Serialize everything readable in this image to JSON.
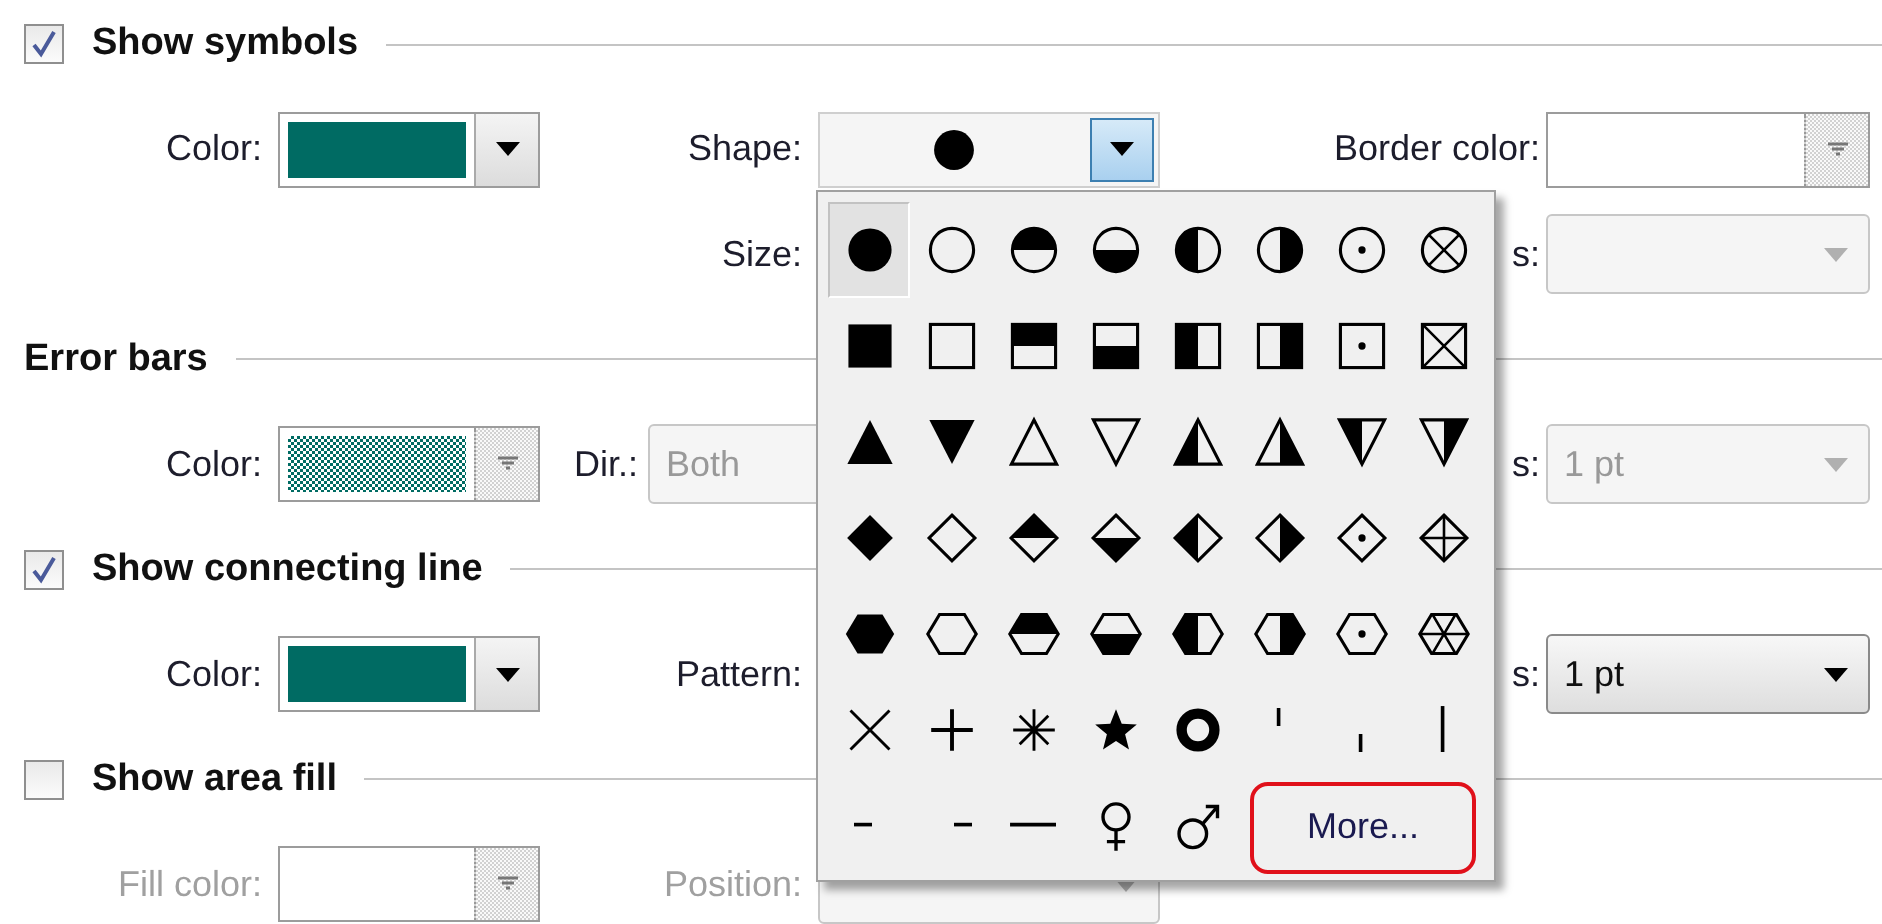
{
  "sections": [
    {
      "kind": "checkbox",
      "title": "Show symbols",
      "checked": true,
      "rows": [
        {
          "left": {
            "label": "Color:",
            "kind": "color",
            "color": "#006b63",
            "disabled": false
          },
          "middle": {
            "label": "Shape:",
            "kind": "shape",
            "expanded": true,
            "menu": {
              "symbols": [
                {
                  "kind": "circle-full",
                  "selected": true
                },
                {
                  "kind": "circle-none",
                  "selected": false
                },
                {
                  "kind": "circle-top",
                  "selected": false
                },
                {
                  "kind": "circle-bottom",
                  "selected": false
                },
                {
                  "kind": "circle-left",
                  "selected": false
                },
                {
                  "kind": "circle-right",
                  "selected": false
                },
                {
                  "kind": "circle-dot",
                  "selected": false
                },
                {
                  "kind": "circle-x",
                  "selected": false
                },
                {
                  "kind": "square-full",
                  "selected": false
                },
                {
                  "kind": "square-none",
                  "selected": false
                },
                {
                  "kind": "square-top",
                  "selected": false
                },
                {
                  "kind": "square-bottom",
                  "selected": false
                },
                {
                  "kind": "square-left",
                  "selected": false
                },
                {
                  "kind": "square-right",
                  "selected": false
                },
                {
                  "kind": "square-dot",
                  "selected": false
                },
                {
                  "kind": "square-x",
                  "selected": false
                },
                {
                  "kind": "triangle-up-full",
                  "selected": false
                },
                {
                  "kind": "triangle-down-full",
                  "selected": false
                },
                {
                  "kind": "triangle-up-none",
                  "selected": false
                },
                {
                  "kind": "triangle-down-none",
                  "selected": false
                },
                {
                  "kind": "triangle-up-left",
                  "selected": false
                },
                {
                  "kind": "triangle-up-right",
                  "selected": false
                },
                {
                  "kind": "triangle-down-left",
                  "selected": false
                },
                {
                  "kind": "triangle-down-right",
                  "selected": false
                },
                {
                  "kind": "diamond-full",
                  "selected": false
                },
                {
                  "kind": "diamond-none",
                  "selected": false
                },
                {
                  "kind": "diamond-top",
                  "selected": false
                },
                {
                  "kind": "diamond-bottom",
                  "selected": false
                },
                {
                  "kind": "diamond-left",
                  "selected": false
                },
                {
                  "kind": "diamond-right",
                  "selected": false
                },
                {
                  "kind": "diamond-dot",
                  "selected": false
                },
                {
                  "kind": "diamond-plus",
                  "selected": false
                },
                {
                  "kind": "hexagon-full",
                  "selected": false
                },
                {
                  "kind": "hexagon-none",
                  "selected": false
                },
                {
                  "kind": "hexagon-top",
                  "selected": false
                },
                {
                  "kind": "hexagon-bottom",
                  "selected": false
                },
                {
                  "kind": "hexagon-left",
                  "selected": false
                },
                {
                  "kind": "hexagon-right",
                  "selected": false
                },
                {
                  "kind": "hexagon-dot",
                  "selected": false
                },
                {
                  "kind": "hexagon-star",
                  "selected": false
                },
                {
                  "kind": "cross",
                  "selected": false
                },
                {
                  "kind": "plus",
                  "selected": false
                },
                {
                  "kind": "asterisk",
                  "selected": false
                },
                {
                  "kind": "star",
                  "selected": false
                },
                {
                  "kind": "ring",
                  "selected": false
                },
                {
                  "kind": "tick-high",
                  "selected": false
                },
                {
                  "kind": "tick-low",
                  "selected": false
                },
                {
                  "kind": "tick-tall",
                  "selected": false
                },
                {
                  "kind": "dash",
                  "selected": false
                },
                {
                  "kind": "dash-right",
                  "selected": false
                },
                {
                  "kind": "dash-long",
                  "selected": false
                },
                {
                  "kind": "female",
                  "selected": false
                },
                {
                  "kind": "male",
                  "selected": false
                }
              ],
              "more_button": "More..."
            }
          },
          "right": {
            "label": "Border color:",
            "kind": "color"
          }
        },
        {
          "middle": {
            "label": "Size:",
            "kind": "label"
          },
          "right": {
            "label": "s:",
            "kind": "select",
            "disabled": true
          }
        }
      ]
    },
    {
      "kind": "heading",
      "title": "Error bars",
      "rows": [
        {
          "left": {
            "label": "Color:",
            "kind": "color",
            "color": "#006b63",
            "disabled": true
          },
          "middle": {
            "label": "Dir.:",
            "kind": "inline-select",
            "value": "Both",
            "disabled": true
          },
          "right": {
            "label": "s:",
            "kind": "select",
            "value": "1 pt",
            "disabled": true
          }
        }
      ]
    },
    {
      "kind": "checkbox",
      "title": "Show connecting line",
      "checked": true,
      "rows": [
        {
          "left": {
            "label": "Color:",
            "kind": "color",
            "color": "#006b63",
            "disabled": false
          },
          "middle": {
            "label": "Pattern:",
            "kind": "label"
          },
          "right": {
            "label": "s:",
            "kind": "select",
            "value": "1 pt",
            "disabled": false
          }
        }
      ]
    },
    {
      "kind": "checkbox",
      "title": "Show area fill",
      "checked": false,
      "rows": [
        {
          "left": {
            "label": "Fill color:",
            "kind": "color"
          },
          "middle": {
            "label": "Position:",
            "kind": "select",
            "disabled": true
          }
        }
      ]
    }
  ]
}
